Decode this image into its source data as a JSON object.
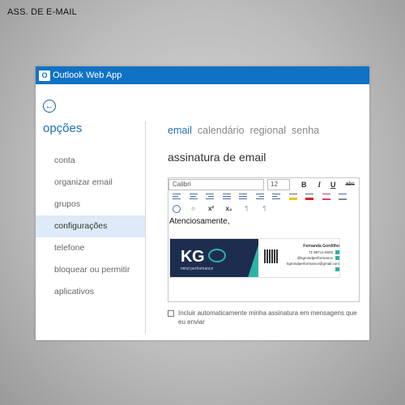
{
  "page_label": "ASS. DE E-MAIL",
  "titlebar": {
    "logo_text": "O",
    "title": "Outlook Web App"
  },
  "back": {
    "glyph": "←"
  },
  "sidebar": {
    "title": "opções",
    "items": [
      {
        "label": "conta"
      },
      {
        "label": "organizar email"
      },
      {
        "label": "grupos"
      },
      {
        "label": "configurações",
        "active": true
      },
      {
        "label": "telefone"
      },
      {
        "label": "bloquear ou permitir"
      },
      {
        "label": "aplicativos"
      }
    ]
  },
  "tabs": [
    {
      "label": "email",
      "active": true
    },
    {
      "label": "calendário"
    },
    {
      "label": "regional"
    },
    {
      "label": "senha"
    }
  ],
  "section_title": "assinatura de email",
  "editor": {
    "font": "Calibri",
    "size": "12",
    "bold": "B",
    "italic": "I",
    "underline": "U",
    "strike": "abc",
    "greeting": "Atenciosamente,"
  },
  "signature": {
    "logo": "KG",
    "subtitle": "mind performance",
    "name": "Fernanda Gordilho",
    "phone": "71 99711-6925",
    "instagram": "@kgmindperformance",
    "email": "kgmindperformance@gmail.com"
  },
  "auto_signature_label": "Incluir automaticamente minha assinatura em mensagens que eu enviar",
  "colors": {
    "titlebar": "#0f72c5",
    "accent": "#1f6fb5",
    "active_item": "#ddeaf7"
  }
}
